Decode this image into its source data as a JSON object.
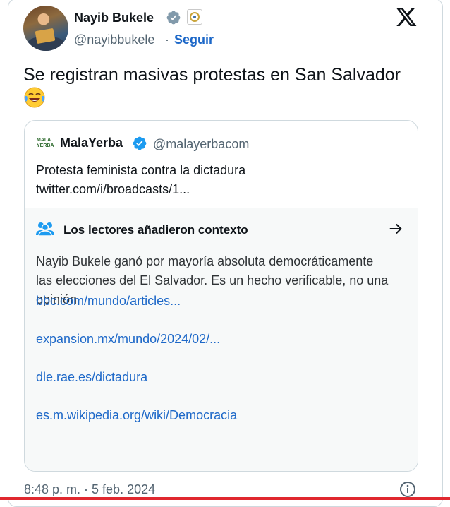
{
  "author": {
    "name": "Nayib Bukele",
    "handle": "@nayibbukele",
    "separator": "·",
    "follow_label": "Seguir"
  },
  "tweet": {
    "text": "Se registran masivas protestas en San Salvador",
    "emoji": "😂"
  },
  "quoted": {
    "logo_text": "MALA YERBA",
    "name": "MalaYerba",
    "handle": "@malayerbacom",
    "text_line1": "Protesta feminista contra la dictadura",
    "text_line2": "twitter.com/i/broadcasts/1..."
  },
  "context": {
    "title": "Los lectores añadieron contexto",
    "body": "Nayib Bukele ganó por mayoría absoluta democráticamente las elecciones del El Salvador. Es un hecho verificable, no una opinión",
    "links": [
      "bbc.com/mundo/articles...",
      "expansion.mx/mundo/2024/02/...",
      "dle.rae.es/dictadura",
      "es.m.wikipedia.org/wiki/Democracia"
    ]
  },
  "footer": {
    "timestamp": "8:48 p. m. · 5 feb. 2024"
  },
  "colors": {
    "verified_badge": "#829aab",
    "quote_verified_badge": "#1d9bf0",
    "link": "#1d68c8",
    "context_icon": "#1d9bf0",
    "bottom_bar": "#e0282f"
  },
  "icons": {
    "verified": "verified-badge-icon",
    "affiliate": "government-seal-icon",
    "x_logo": "x-logo-icon",
    "community": "people-icon",
    "arrow": "arrow-right-icon",
    "info": "info-icon"
  }
}
